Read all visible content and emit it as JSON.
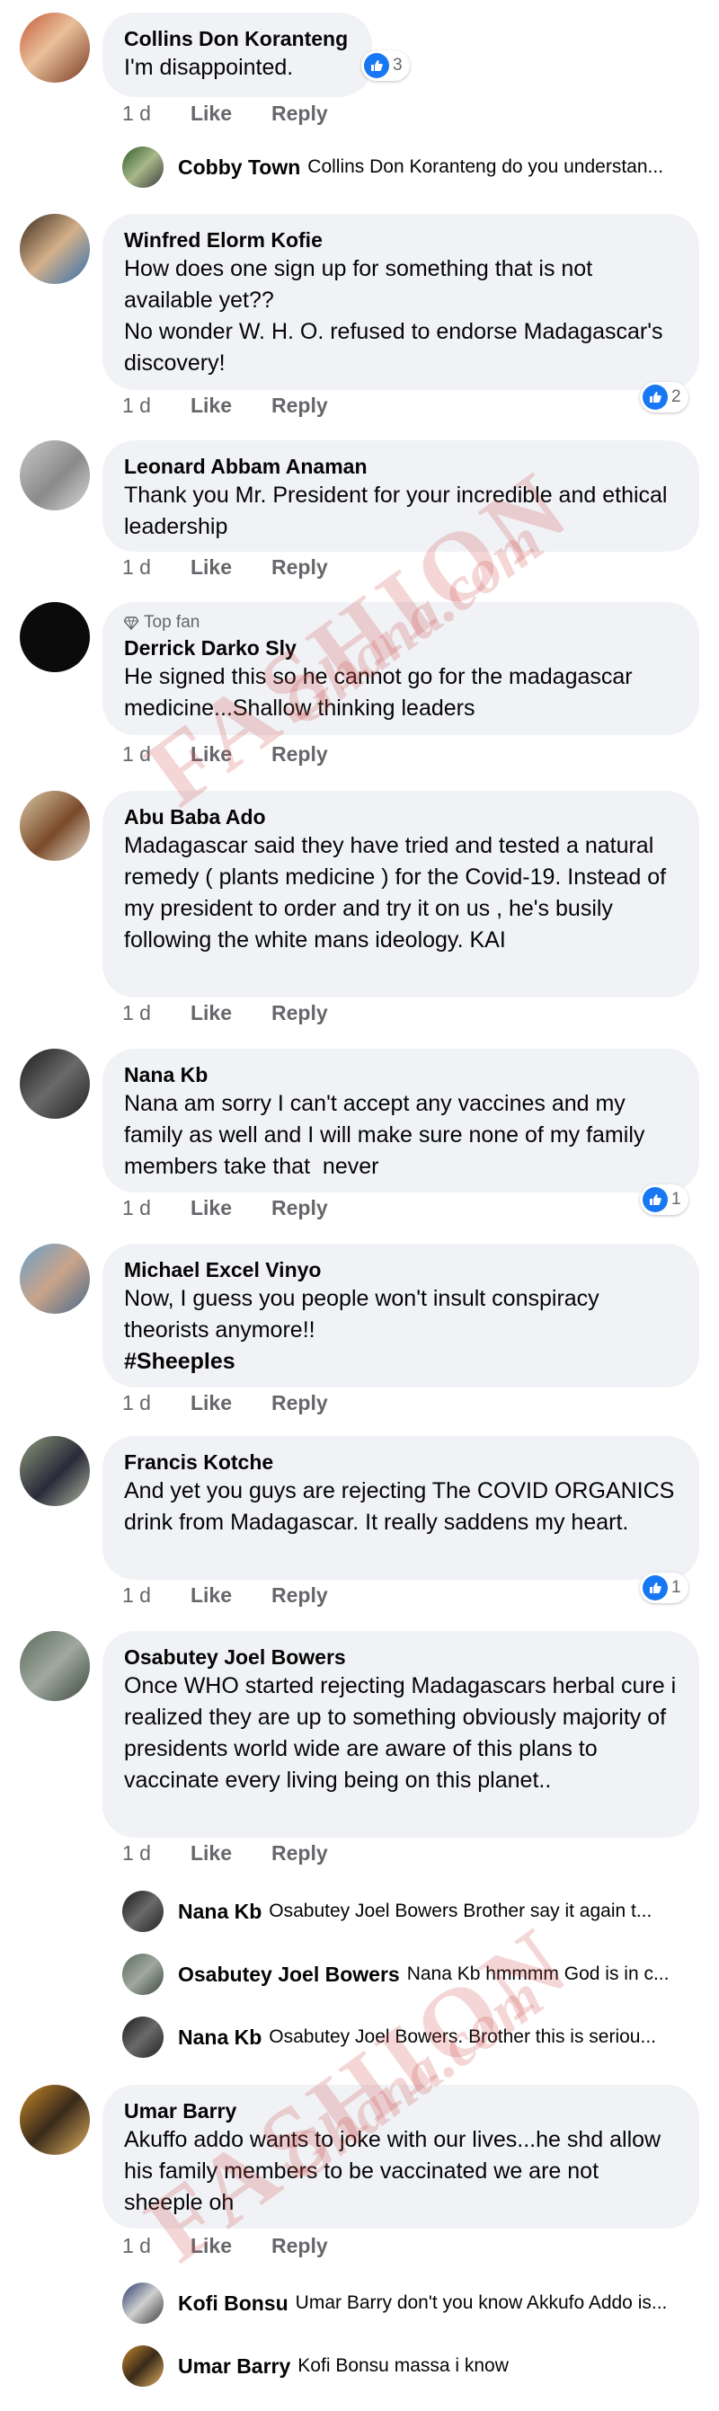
{
  "comments": [
    {
      "name": "Collins Don Koranteng",
      "text": "I'm disappointed.",
      "time": "1 d",
      "like": "Like",
      "reply": "Reply",
      "reactions": "3"
    },
    {
      "name": "Winfred Elorm Kofie",
      "text": "How does one sign up for something that is not available yet??\nNo wonder W. H. O. refused to endorse Madagascar's discovery!",
      "time": "1 d",
      "like": "Like",
      "reply": "Reply",
      "reactions": "2"
    },
    {
      "name": "Leonard Abbam Anaman",
      "text": "Thank you Mr. President for your incredible and ethical leadership",
      "time": "1 d",
      "like": "Like",
      "reply": "Reply"
    },
    {
      "badge": "Top fan",
      "name": "Derrick Darko Sly",
      "text": "He signed this so he cannot go for the madagascar medicine...Shallow thinking leaders",
      "time": "1 d",
      "like": "Like",
      "reply": "Reply"
    },
    {
      "name": "Abu Baba Ado",
      "text": "Madagascar said they have tried and tested a natural remedy ( plants medicine ) for the Covid-19. Instead of my president to order and try it on us , he's busily following the white mans ideology. KAI",
      "time": "1 d",
      "like": "Like",
      "reply": "Reply"
    },
    {
      "name": "Nana Kb",
      "text": "Nana am sorry I can't accept any vaccines and my family as well and I will make sure none of my family members take that  never",
      "time": "1 d",
      "like": "Like",
      "reply": "Reply",
      "reactions": "1"
    },
    {
      "name": "Michael Excel Vinyo",
      "text": "Now, I guess you people won't insult conspiracy theorists anymore!!",
      "hashtag": "#Sheeples",
      "time": "1 d",
      "like": "Like",
      "reply": "Reply"
    },
    {
      "name": "Francis Kotche",
      "text": "And yet you guys are rejecting The COVID ORGANICS drink from Madagascar. It really saddens my heart.",
      "time": "1 d",
      "like": "Like",
      "reply": "Reply",
      "reactions": "1"
    },
    {
      "name": "Osabutey Joel Bowers",
      "text": "Once WHO started rejecting Madagascars herbal cure i realized they are up to something obviously majority of presidents world wide are aware of this plans to vaccinate every living being on this planet..",
      "time": "1 d",
      "like": "Like",
      "reply": "Reply"
    },
    {
      "name": "Umar Barry",
      "text": "Akuffo addo wants to joke with our lives...he shd allow his family members to be vaccinated we are not sheeple oh",
      "time": "1 d",
      "like": "Like",
      "reply": "Reply"
    }
  ],
  "replies": [
    {
      "name": "Cobby Town",
      "text": "Collins Don Koranteng do you understan..."
    },
    {
      "name": "Nana Kb",
      "text": "Osabutey Joel Bowers  Brother say it again t..."
    },
    {
      "name": "Osabutey Joel Bowers",
      "text": "Nana Kb hmmmm God is in c..."
    },
    {
      "name": "Nana Kb",
      "text": "Osabutey Joel Bowers. Brother this is seriou..."
    },
    {
      "name": "Kofi Bonsu",
      "text": "Umar Barry don't you know Akkufo Addo is..."
    },
    {
      "name": "Umar Barry",
      "text": "Kofi Bonsu massa i know"
    }
  ],
  "watermark": {
    "line1": "FASHION",
    "line2": "Ghana.com"
  },
  "colors": {
    "bubble": "#f0f2f5",
    "meta": "#65676b",
    "like_blue": "#1877f2",
    "watermark": "#cd4646"
  },
  "icons": {
    "reaction": "thumbs-up-icon",
    "top_fan": "diamond-icon"
  }
}
